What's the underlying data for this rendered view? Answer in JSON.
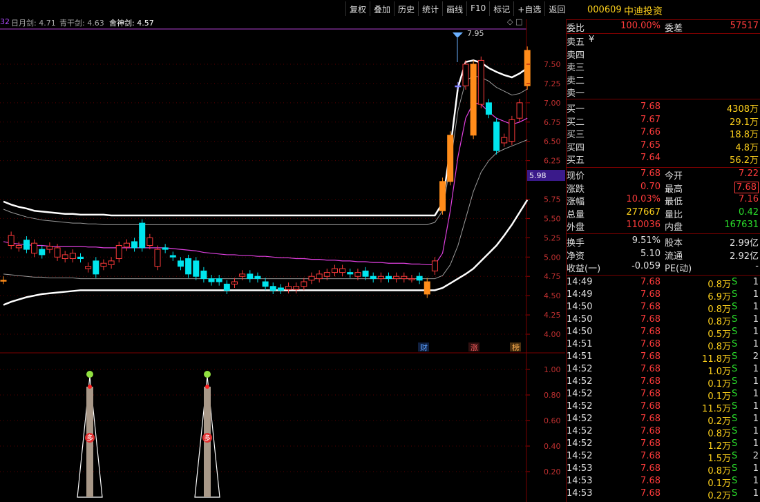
{
  "toolbar": [
    "复权",
    "叠加",
    "历史",
    "统计",
    "画线",
    "F10",
    "标记",
    "+自选",
    "返回"
  ],
  "stock": {
    "code": "000609",
    "name": "中迪投资"
  },
  "indicators": {
    "prefix": "32",
    "a_label": "日月剑: 4.71",
    "b_label": "青干剑: 4.63",
    "c_label": "舍神剑: 4.57",
    "icons": "◇ □"
  },
  "price_axis": [
    "7.50",
    "7.25",
    "7.00",
    "6.75",
    "6.50",
    "6.25",
    "5.75",
    "5.50",
    "5.25",
    "5.00",
    "4.75",
    "4.50",
    "4.25",
    "4.00"
  ],
  "price_badge": "5.98",
  "high_label": "7.95",
  "sub_axis": [
    "1.00",
    "0.80",
    "0.60",
    "0.40",
    "0.20"
  ],
  "markers": {
    "cai": "财",
    "zhang": "涨",
    "bang": "榜"
  },
  "sub_marker": "多",
  "colors": {
    "up": "#ff3b3b",
    "down": "#00e5ee",
    "orange": "#ff8c1a",
    "magenta": "#e040e0",
    "violet": "#8080ff",
    "white": "#ffffff",
    "gray": "#9a9a9a"
  },
  "order_book": {
    "weibi_label": "委比",
    "weibi_value": "100.00%",
    "weicha_label": "委差",
    "weicha_value": "57517",
    "sells": [
      {
        "label": "卖五",
        "price": "¥"
      },
      {
        "label": "卖四",
        "price": ""
      },
      {
        "label": "卖三",
        "price": ""
      },
      {
        "label": "卖二",
        "price": ""
      },
      {
        "label": "卖一",
        "price": ""
      }
    ],
    "buys": [
      {
        "label": "买一",
        "price": "7.68",
        "vol": "4308万"
      },
      {
        "label": "买二",
        "price": "7.67",
        "vol": "29.1万"
      },
      {
        "label": "买三",
        "price": "7.66",
        "vol": "18.8万"
      },
      {
        "label": "买四",
        "price": "7.65",
        "vol": "4.8万"
      },
      {
        "label": "买五",
        "price": "7.64",
        "vol": "56.2万"
      }
    ]
  },
  "quote": [
    {
      "l1": "现价",
      "v1": "7.68",
      "l2": "今开",
      "v2": "7.22"
    },
    {
      "l1": "涨跌",
      "v1": "0.70",
      "l2": "最高",
      "v2": "7.68"
    },
    {
      "l1": "涨幅",
      "v1": "10.03%",
      "l2": "最低",
      "v2": "7.16"
    },
    {
      "l1": "总量",
      "v1": "277667",
      "l2": "量比",
      "v2": "0.42"
    },
    {
      "l1": "外盘",
      "v1": "110036",
      "l2": "内盘",
      "v2": "167631"
    }
  ],
  "fundamentals": [
    {
      "l1": "换手",
      "v1": "9.51%",
      "l2": "股本",
      "v2": "2.99亿"
    },
    {
      "l1": "净资",
      "v1": "5.10",
      "l2": "流通",
      "v2": "2.92亿"
    },
    {
      "l1": "收益(一)",
      "v1": "-0.059",
      "l2": "PE(动)",
      "v2": "-"
    }
  ],
  "ticks": [
    {
      "time": "14:49",
      "price": "7.68",
      "vol": "0.8万",
      "side": "S",
      "count": "1"
    },
    {
      "time": "14:49",
      "price": "7.68",
      "vol": "6.9万",
      "side": "S",
      "count": "1"
    },
    {
      "time": "14:50",
      "price": "7.68",
      "vol": "0.8万",
      "side": "S",
      "count": "1"
    },
    {
      "time": "14:50",
      "price": "7.68",
      "vol": "0.8万",
      "side": "S",
      "count": "1"
    },
    {
      "time": "14:50",
      "price": "7.68",
      "vol": "0.5万",
      "side": "S",
      "count": "1"
    },
    {
      "time": "14:51",
      "price": "7.68",
      "vol": "0.8万",
      "side": "S",
      "count": "1"
    },
    {
      "time": "14:51",
      "price": "7.68",
      "vol": "11.8万",
      "side": "S",
      "count": "2"
    },
    {
      "time": "14:52",
      "price": "7.68",
      "vol": "1.0万",
      "side": "S",
      "count": "1"
    },
    {
      "time": "14:52",
      "price": "7.68",
      "vol": "0.1万",
      "side": "S",
      "count": "1"
    },
    {
      "time": "14:52",
      "price": "7.68",
      "vol": "0.1万",
      "side": "S",
      "count": "1"
    },
    {
      "time": "14:52",
      "price": "7.68",
      "vol": "11.5万",
      "side": "S",
      "count": "1"
    },
    {
      "time": "14:52",
      "price": "7.68",
      "vol": "0.2万",
      "side": "S",
      "count": "1"
    },
    {
      "time": "14:52",
      "price": "7.68",
      "vol": "0.8万",
      "side": "S",
      "count": "1"
    },
    {
      "time": "14:52",
      "price": "7.68",
      "vol": "1.2万",
      "side": "S",
      "count": "1"
    },
    {
      "time": "14:52",
      "price": "7.68",
      "vol": "1.5万",
      "side": "S",
      "count": "2"
    },
    {
      "time": "14:53",
      "price": "7.68",
      "vol": "0.8万",
      "side": "S",
      "count": "1"
    },
    {
      "time": "14:53",
      "price": "7.68",
      "vol": "0.1万",
      "side": "S",
      "count": "1"
    },
    {
      "time": "14:53",
      "price": "7.68",
      "vol": "0.2万",
      "side": "S",
      "count": "1"
    }
  ],
  "chart_data": {
    "type": "candlestick",
    "ylim": [
      3.9,
      7.95
    ],
    "candles": [
      {
        "o": 4.7,
        "c": 4.7
      },
      {
        "o": 5.15,
        "c": 5.28
      },
      {
        "o": 5.12,
        "c": 5.15
      },
      {
        "o": 5.22,
        "c": 5.1
      },
      {
        "o": 5.05,
        "c": 5.18
      },
      {
        "o": 5.1,
        "c": 5.03
      },
      {
        "o": 5.1,
        "c": 5.14
      },
      {
        "o": 5.0,
        "c": 5.12
      },
      {
        "o": 4.98,
        "c": 5.03
      },
      {
        "o": 4.98,
        "c": 5.05
      },
      {
        "o": 5.0,
        "c": 4.98
      },
      {
        "o": 4.85,
        "c": 4.88
      },
      {
        "o": 4.95,
        "c": 4.78
      },
      {
        "o": 4.88,
        "c": 4.92
      },
      {
        "o": 4.9,
        "c": 4.95
      },
      {
        "o": 4.98,
        "c": 5.15
      },
      {
        "o": 5.13,
        "c": 5.18
      },
      {
        "o": 5.2,
        "c": 5.12
      },
      {
        "o": 5.44,
        "c": 5.12
      },
      {
        "o": 5.15,
        "c": 5.25
      },
      {
        "o": 4.88,
        "c": 5.1
      },
      {
        "o": 5.12,
        "c": 5.1
      },
      {
        "o": 5.02,
        "c": 5.0
      },
      {
        "o": 4.95,
        "c": 4.88
      },
      {
        "o": 4.98,
        "c": 4.78
      },
      {
        "o": 4.95,
        "c": 4.75
      },
      {
        "o": 4.82,
        "c": 4.72
      },
      {
        "o": 4.72,
        "c": 4.68
      },
      {
        "o": 4.72,
        "c": 4.68
      },
      {
        "o": 4.65,
        "c": 4.57
      },
      {
        "o": 4.65,
        "c": 4.68
      },
      {
        "o": 4.75,
        "c": 4.78
      },
      {
        "o": 4.78,
        "c": 4.72
      },
      {
        "o": 4.75,
        "c": 4.72
      },
      {
        "o": 4.68,
        "c": 4.62
      },
      {
        "o": 4.62,
        "c": 4.57
      },
      {
        "o": 4.6,
        "c": 4.57
      },
      {
        "o": 4.58,
        "c": 4.62
      },
      {
        "o": 4.58,
        "c": 4.62
      },
      {
        "o": 4.62,
        "c": 4.68
      },
      {
        "o": 4.7,
        "c": 4.75
      },
      {
        "o": 4.72,
        "c": 4.78
      },
      {
        "o": 4.75,
        "c": 4.8
      },
      {
        "o": 4.8,
        "c": 4.85
      },
      {
        "o": 4.8,
        "c": 4.85
      },
      {
        "o": 4.8,
        "c": 4.78
      },
      {
        "o": 4.75,
        "c": 4.8
      },
      {
        "o": 4.82,
        "c": 4.75
      },
      {
        "o": 4.75,
        "c": 4.72
      },
      {
        "o": 4.72,
        "c": 4.75
      },
      {
        "o": 4.75,
        "c": 4.72
      },
      {
        "o": 4.72,
        "c": 4.75
      },
      {
        "o": 4.72,
        "c": 4.75
      },
      {
        "o": 4.72,
        "c": 4.72
      },
      {
        "o": 4.75,
        "c": 4.7
      },
      {
        "o": 4.68,
        "c": 4.52
      },
      {
        "o": 4.82,
        "c": 4.95
      },
      {
        "o": 5.6,
        "c": 5.98
      },
      {
        "o": 5.98,
        "c": 6.58
      },
      {
        "o": 7.22,
        "c": 7.22
      },
      {
        "o": 7.22,
        "c": 7.5
      },
      {
        "o": 7.5,
        "c": 6.58
      },
      {
        "o": 6.98,
        "c": 7.55
      },
      {
        "o": 7.0,
        "c": 6.85
      },
      {
        "o": 6.75,
        "c": 6.38
      },
      {
        "o": 6.48,
        "c": 6.55
      },
      {
        "o": 6.5,
        "c": 6.78
      },
      {
        "o": 6.8,
        "c": 7.0
      },
      {
        "o": 7.22,
        "c": 7.68
      }
    ],
    "bands": {
      "outer_upper": [
        5.72,
        5.68,
        5.65,
        5.63,
        5.6,
        5.59,
        5.58,
        5.57,
        5.56,
        5.56,
        5.55,
        5.55,
        5.55,
        5.55,
        5.54,
        5.54,
        5.54,
        5.54,
        5.54,
        5.54,
        5.54,
        5.54,
        5.54,
        5.54,
        5.54,
        5.54,
        5.54,
        5.54,
        5.54,
        5.54,
        5.54,
        5.54,
        5.54,
        5.54,
        5.54,
        5.54,
        5.54,
        5.54,
        5.54,
        5.54,
        5.54,
        5.54,
        5.54,
        5.54,
        5.54,
        5.54,
        5.54,
        5.54,
        5.54,
        5.54,
        5.54,
        5.54,
        5.54,
        5.54,
        5.54,
        5.54,
        5.54,
        5.7,
        6.4,
        7.2,
        7.53,
        7.55,
        7.52,
        7.45,
        7.4,
        7.36,
        7.33,
        7.38,
        7.45
      ],
      "inner_upper": [
        5.62,
        5.58,
        5.55,
        5.52,
        5.5,
        5.48,
        5.47,
        5.46,
        5.45,
        5.44,
        5.44,
        5.43,
        5.43,
        5.42,
        5.42,
        5.42,
        5.42,
        5.42,
        5.42,
        5.42,
        5.42,
        5.42,
        5.42,
        5.42,
        5.42,
        5.42,
        5.42,
        5.42,
        5.42,
        5.42,
        5.42,
        5.42,
        5.42,
        5.42,
        5.42,
        5.42,
        5.42,
        5.42,
        5.42,
        5.42,
        5.42,
        5.42,
        5.42,
        5.42,
        5.42,
        5.42,
        5.42,
        5.42,
        5.42,
        5.42,
        5.42,
        5.42,
        5.42,
        5.42,
        5.42,
        5.42,
        5.45,
        5.6,
        6.2,
        6.9,
        7.28,
        7.35,
        7.33,
        7.28,
        7.2,
        7.15,
        7.1,
        7.12,
        7.18
      ],
      "mid": [
        5.2,
        5.18,
        5.17,
        5.16,
        5.15,
        5.15,
        5.14,
        5.14,
        5.14,
        5.14,
        5.14,
        5.13,
        5.13,
        5.12,
        5.12,
        5.12,
        5.12,
        5.12,
        5.12,
        5.12,
        5.12,
        5.12,
        5.11,
        5.1,
        5.09,
        5.08,
        5.06,
        5.05,
        5.04,
        5.03,
        5.03,
        5.02,
        5.02,
        5.01,
        5.01,
        5.0,
        4.99,
        4.99,
        4.98,
        4.98,
        4.97,
        4.97,
        4.96,
        4.96,
        4.95,
        4.95,
        4.94,
        4.94,
        4.93,
        4.93,
        4.92,
        4.92,
        4.92,
        4.91,
        4.91,
        4.9,
        4.9,
        5.05,
        5.6,
        6.3,
        6.8,
        7.0,
        6.98,
        6.88,
        6.8,
        6.76,
        6.72,
        6.75,
        6.8
      ],
      "inner_lower": [
        4.78,
        4.77,
        4.76,
        4.75,
        4.74,
        4.74,
        4.73,
        4.73,
        4.73,
        4.73,
        4.72,
        4.72,
        4.72,
        4.72,
        4.72,
        4.72,
        4.72,
        4.72,
        4.72,
        4.72,
        4.72,
        4.72,
        4.72,
        4.72,
        4.72,
        4.72,
        4.72,
        4.72,
        4.72,
        4.72,
        4.72,
        4.72,
        4.72,
        4.72,
        4.72,
        4.72,
        4.72,
        4.72,
        4.72,
        4.72,
        4.72,
        4.72,
        4.72,
        4.72,
        4.72,
        4.72,
        4.72,
        4.72,
        4.72,
        4.72,
        4.72,
        4.72,
        4.72,
        4.72,
        4.72,
        4.72,
        4.72,
        4.76,
        4.9,
        5.15,
        5.5,
        5.85,
        6.1,
        6.25,
        6.35,
        6.4,
        6.44,
        6.48,
        6.52
      ],
      "outer_lower": [
        4.38,
        4.42,
        4.45,
        4.48,
        4.5,
        4.52,
        4.53,
        4.54,
        4.55,
        4.56,
        4.57,
        4.57,
        4.57,
        4.57,
        4.57,
        4.57,
        4.57,
        4.57,
        4.57,
        4.57,
        4.57,
        4.57,
        4.57,
        4.57,
        4.57,
        4.57,
        4.57,
        4.57,
        4.57,
        4.57,
        4.57,
        4.57,
        4.57,
        4.57,
        4.57,
        4.57,
        4.57,
        4.57,
        4.57,
        4.57,
        4.57,
        4.57,
        4.57,
        4.57,
        4.57,
        4.57,
        4.57,
        4.57,
        4.57,
        4.57,
        4.57,
        4.57,
        4.57,
        4.57,
        4.57,
        4.57,
        4.57,
        4.6,
        4.66,
        4.72,
        4.78,
        4.85,
        4.95,
        5.05,
        5.15,
        5.28,
        5.42,
        5.58,
        5.74
      ]
    },
    "sub_values": [
      0,
      0,
      0,
      0,
      0,
      0,
      0,
      0,
      0,
      1,
      0,
      0,
      0,
      0,
      0,
      0,
      0,
      0,
      0,
      0,
      0,
      0,
      1,
      0,
      0,
      0,
      0,
      0,
      0,
      0
    ]
  }
}
